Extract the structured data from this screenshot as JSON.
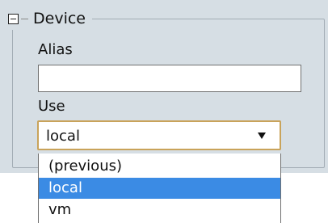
{
  "fieldset": {
    "legend": "Device",
    "collapse_icon": "minus-box-icon"
  },
  "alias": {
    "label": "Alias",
    "value": "",
    "placeholder": ""
  },
  "use": {
    "label": "Use",
    "selected": "local",
    "arrow_icon": "triangle-down-icon",
    "options": [
      "(previous)",
      "local",
      "vm"
    ],
    "highlighted_option": "local"
  },
  "colors": {
    "panel_background": "#d6dee4",
    "selected_option_background": "#3b8be4",
    "select_focus_border": "#c9a35a"
  }
}
